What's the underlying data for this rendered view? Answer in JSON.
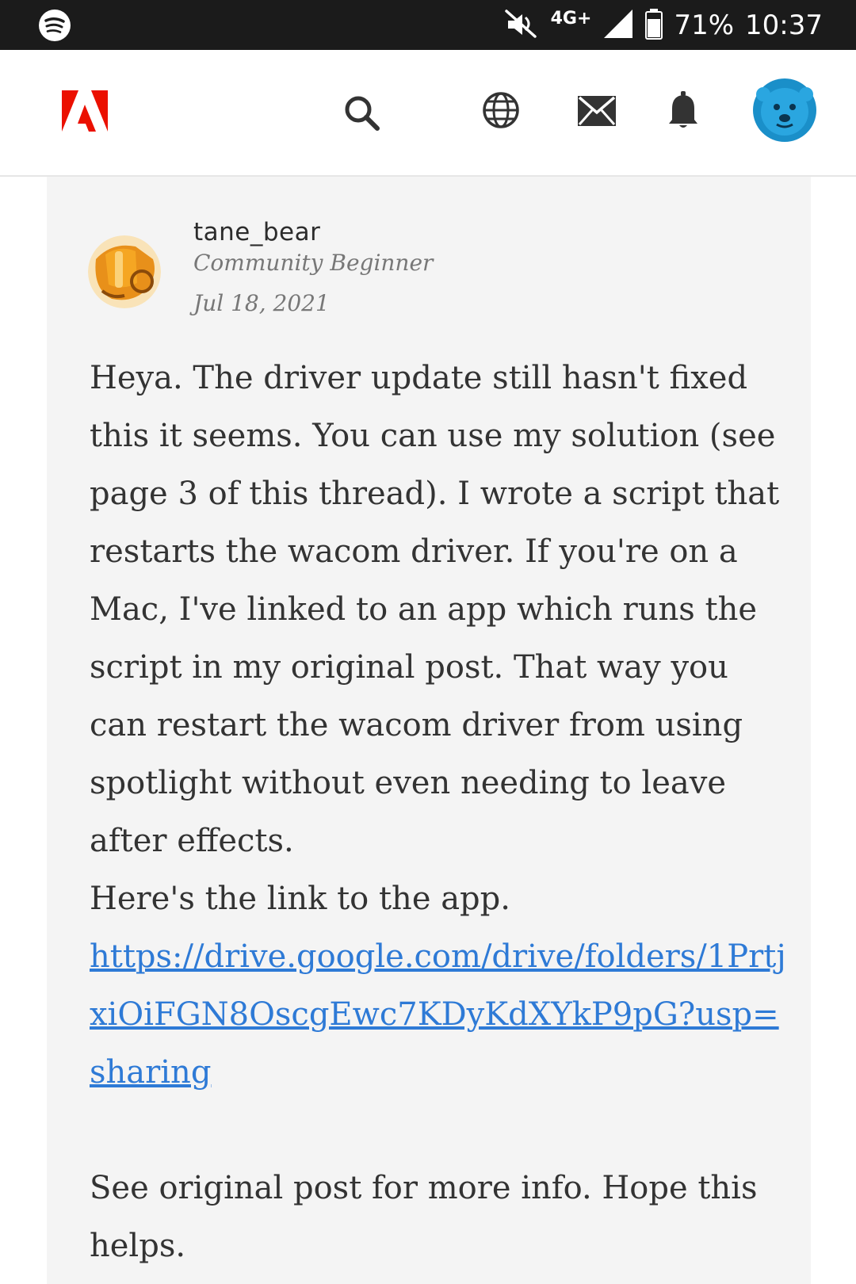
{
  "status_bar": {
    "network": "4G+",
    "battery": "71%",
    "time": "10:37",
    "icons": [
      "spotify-icon",
      "mute-icon",
      "signal-icon",
      "battery-icon"
    ]
  },
  "header": {
    "icons": [
      "adobe-logo",
      "search-icon",
      "globe-icon",
      "mail-icon",
      "bell-icon",
      "user-avatar"
    ],
    "brand_color": "#eb1000",
    "avatar_color": "#1a8fc9"
  },
  "post": {
    "username": "tane_bear",
    "rank": "Community Beginner",
    "date": "Jul 18, 2021",
    "body_paragraph_1": "Heya. The driver update still hasn't fixed this it seems. You can use my solution (see page 3 of this thread). I wrote a script that restarts the wacom driver. If you're on a Mac, I've linked to an app which runs the script in my original post. That way you can restart the wacom driver from using spotlight without even needing to leave after effects.",
    "body_paragraph_2": "Here's the link to the app.",
    "link_text": "https://drive.google.com/drive/folders/1PrtjxiOiFGN8OscgEwc7KDyKdXYkP9pG?usp=sharing",
    "body_paragraph_3": "See original post for more info. Hope this helps.",
    "link_color": "#2e7ad6"
  }
}
